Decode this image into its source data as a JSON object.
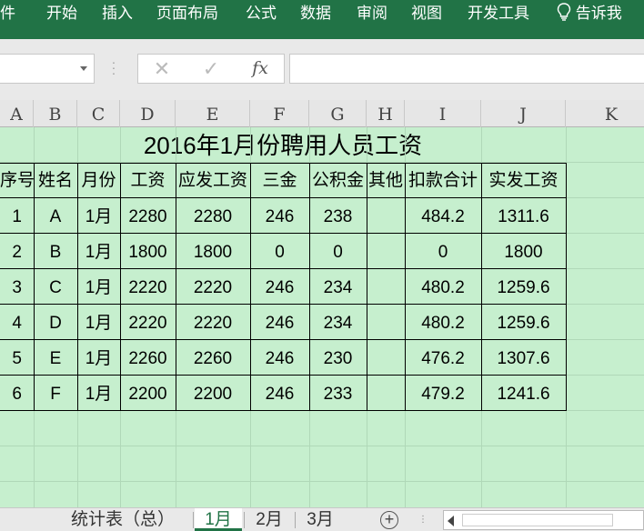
{
  "ribbon": {
    "menu": [
      "件",
      "开始",
      "插入",
      "页面布局",
      "公式",
      "数据",
      "审阅",
      "视图",
      "开发工具"
    ],
    "tell_me": "告诉我"
  },
  "formula_bar": {
    "name_box_value": "",
    "cancel_symbol": "✕",
    "enter_symbol": "✓",
    "fx_label": "fx",
    "formula_value": ""
  },
  "columns": [
    "A",
    "B",
    "C",
    "D",
    "E",
    "F",
    "G",
    "H",
    "I",
    "J",
    "K"
  ],
  "sheet": {
    "title": "2016年1月份聘用人员工资",
    "headers": [
      "序号",
      "姓名",
      "月份",
      "工资",
      "应发工资",
      "三金",
      "公积金",
      "其他",
      "扣款合计",
      "实发工资"
    ],
    "rows": [
      [
        "1",
        "A",
        "1月",
        "2280",
        "2280",
        "246",
        "238",
        "",
        "484.2",
        "1311.6"
      ],
      [
        "2",
        "B",
        "1月",
        "1800",
        "1800",
        "0",
        "0",
        "",
        "0",
        "1800"
      ],
      [
        "3",
        "C",
        "1月",
        "2220",
        "2220",
        "246",
        "234",
        "",
        "480.2",
        "1259.6"
      ],
      [
        "4",
        "D",
        "1月",
        "2220",
        "2220",
        "246",
        "234",
        "",
        "480.2",
        "1259.6"
      ],
      [
        "5",
        "E",
        "1月",
        "2260",
        "2260",
        "246",
        "230",
        "",
        "476.2",
        "1307.6"
      ],
      [
        "6",
        "F",
        "1月",
        "2200",
        "2200",
        "246",
        "233",
        "",
        "479.2",
        "1241.6"
      ]
    ]
  },
  "tabs": {
    "items": [
      "统计表（总）",
      "1月",
      "2月",
      "3月"
    ],
    "active": "1月"
  },
  "colors": {
    "ribbon": "#217346",
    "grid_fill": "#c6efce"
  }
}
